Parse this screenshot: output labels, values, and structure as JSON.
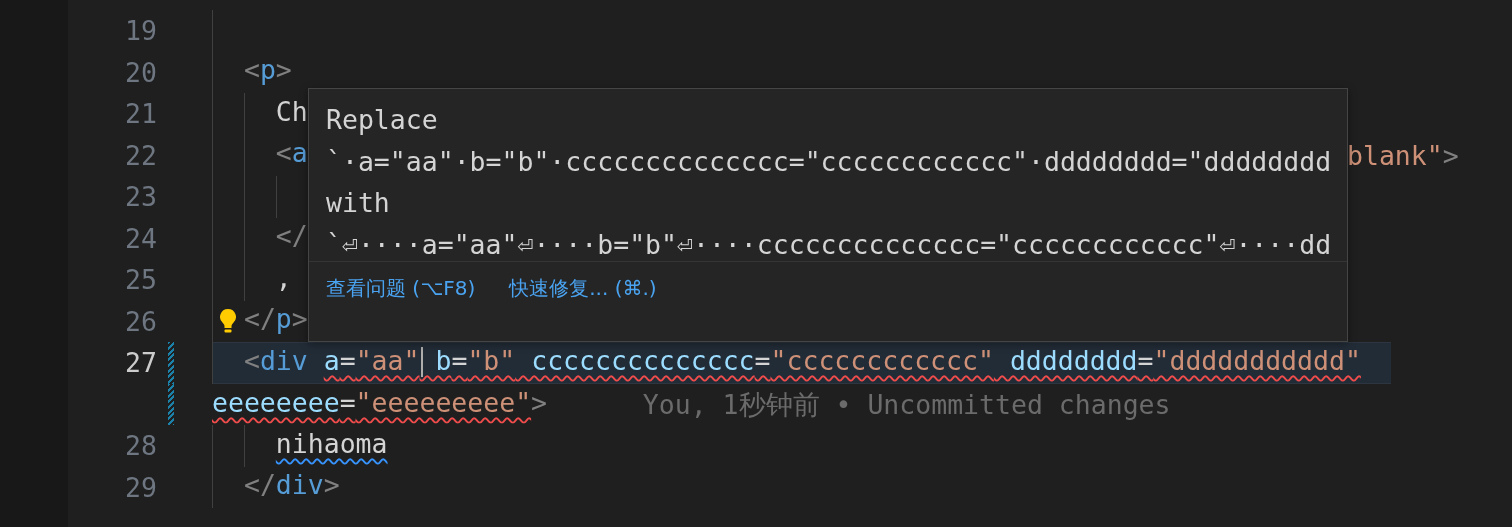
{
  "editor": {
    "lines": [
      {
        "number": "19",
        "current": false,
        "modified": false,
        "lightbulb": false
      },
      {
        "number": "20",
        "current": false,
        "modified": false,
        "lightbulb": false,
        "tokens": [
          {
            "text": "<",
            "kind": "bracket"
          },
          {
            "text": "p",
            "kind": "tag"
          },
          {
            "text": ">",
            "kind": "bracket"
          }
        ],
        "children": [
          {
            "number": "21",
            "current": false,
            "modified": false,
            "lightbulb": false,
            "tokens": [
              {
                "text": "Ch",
                "kind": "text"
              }
            ]
          },
          {
            "number": "22",
            "current": false,
            "modified": false,
            "lightbulb": false,
            "tokens": [
              {
                "text": "<",
                "kind": "bracket"
              },
              {
                "text": "a",
                "kind": "tag"
              }
            ],
            "tail": [
              {
                "text": "blank\"",
                "kind": "string"
              },
              {
                "text": ">",
                "kind": "bracket"
              }
            ],
            "children": [
              {
                "number": "23",
                "current": false,
                "modified": false,
                "lightbulb": false
              }
            ]
          },
          {
            "number": "24",
            "current": false,
            "modified": false,
            "lightbulb": false,
            "tokens": [
              {
                "text": "</",
                "kind": "bracket"
              }
            ]
          },
          {
            "number": "25",
            "current": false,
            "modified": false,
            "lightbulb": false,
            "tokens": [
              {
                "text": ",",
                "kind": "text"
              }
            ]
          }
        ]
      },
      {
        "number": "26",
        "current": false,
        "modified": false,
        "lightbulb": true,
        "tokens": [
          {
            "text": "</",
            "kind": "bracket"
          },
          {
            "text": "p",
            "kind": "tag"
          },
          {
            "text": ">",
            "kind": "bracket"
          }
        ]
      },
      {
        "number": "27",
        "current": true,
        "modified": true,
        "lightbulb": false,
        "tokens": [
          {
            "text": "<",
            "kind": "bracket"
          },
          {
            "text": "div ",
            "kind": "tag",
            "error": false
          },
          {
            "text": "a",
            "kind": "attr",
            "error": true
          },
          {
            "text": "=",
            "kind": "text",
            "error": true
          },
          {
            "text": "\"aa\"",
            "kind": "string",
            "error": true,
            "cursor": true
          },
          {
            "text": " b",
            "kind": "attr",
            "error": true
          },
          {
            "text": "=",
            "kind": "text",
            "error": true
          },
          {
            "text": "\"b\"",
            "kind": "string",
            "error": true
          },
          {
            "text": " cccccccccccccc",
            "kind": "attr",
            "error": true
          },
          {
            "text": "=",
            "kind": "text",
            "error": true
          },
          {
            "text": "\"cccccccccccc\"",
            "kind": "string",
            "error": true
          },
          {
            "text": " dddddddd",
            "kind": "attr",
            "error": true
          },
          {
            "text": "=",
            "kind": "text",
            "error": true
          },
          {
            "text": "\"ddddddddddd\"",
            "kind": "string",
            "error": true
          }
        ],
        "wrap": [
          {
            "text": "eeeeeeee",
            "kind": "attr",
            "error": true
          },
          {
            "text": "=",
            "kind": "text",
            "error": true
          },
          {
            "text": "\"eeeeeeeee\"",
            "kind": "string",
            "error": true
          },
          {
            "text": ">",
            "kind": "bracket",
            "error": false
          }
        ],
        "blame": "You, 1秒钟前 • Uncommitted changes",
        "children": [
          {
            "number": "28",
            "current": false,
            "modified": false,
            "lightbulb": false,
            "tokens": [
              {
                "text": "nihaoma",
                "kind": "text",
                "hint": true
              }
            ]
          }
        ]
      },
      {
        "number": "29",
        "current": false,
        "modified": false,
        "lightbulb": false,
        "tokens": [
          {
            "text": "</",
            "kind": "bracket"
          },
          {
            "text": "div",
            "kind": "tag"
          },
          {
            "text": ">",
            "kind": "bracket"
          }
        ]
      }
    ]
  },
  "hover": {
    "title": "Replace",
    "original": "`·a=\"aa\"·b=\"b\"·cccccccccccccc=\"cccccccccccc\"·dddddddd=\"dddddddd",
    "with_label": "with",
    "replacement": "`⏎····a=\"aa\"⏎····b=\"b\"⏎····cccccccccccccc=\"cccccccccccc\"⏎····dd",
    "actions": [
      {
        "label": "查看问题 (⌥F8)"
      },
      {
        "label": "快速修复... (⌘.)"
      }
    ]
  }
}
